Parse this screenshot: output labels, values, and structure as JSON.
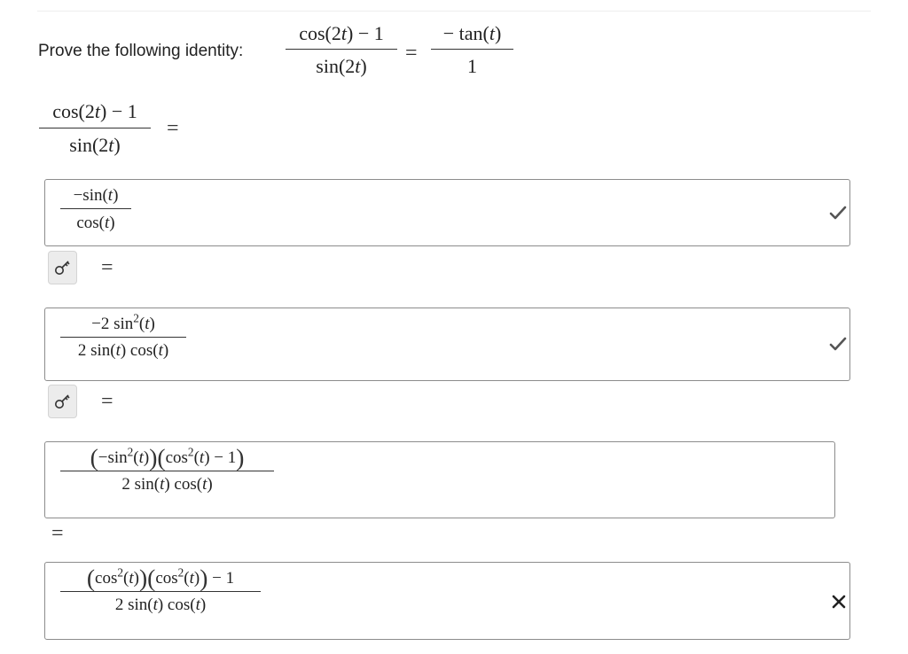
{
  "problem": {
    "prompt": "Prove the following identity:",
    "lhs": {
      "num": "cos(2t) − 1",
      "den": "sin(2t)"
    },
    "rhs": {
      "num": "− tan(t)",
      "den": "1"
    }
  },
  "start": {
    "num": "cos(2t) − 1",
    "den": "sin(2t)",
    "equals": "="
  },
  "steps": [
    {
      "num": "−sin(t)",
      "den": "cos(t)",
      "status": "correct",
      "status_icon": "checkmark-icon",
      "status_color": "#555555"
    },
    {
      "num": "−2 sin²(t)",
      "den": "2 sin(t) cos(t)",
      "status": "correct",
      "status_icon": "checkmark-icon",
      "status_color": "#555555"
    },
    {
      "num": "(−sin²(t))(cos²(t) − 1)",
      "den": "2 sin(t) cos(t)",
      "status": "",
      "status_icon": "",
      "status_color": ""
    },
    {
      "num": "(cos²(t))(cos²(t)) − 1",
      "den": "2 sin(t) cos(t)",
      "status": "incorrect",
      "status_icon": "x-mark-icon",
      "status_color": "#222222"
    }
  ],
  "equals_sign": "=",
  "hint_button_icon": "key-icon"
}
